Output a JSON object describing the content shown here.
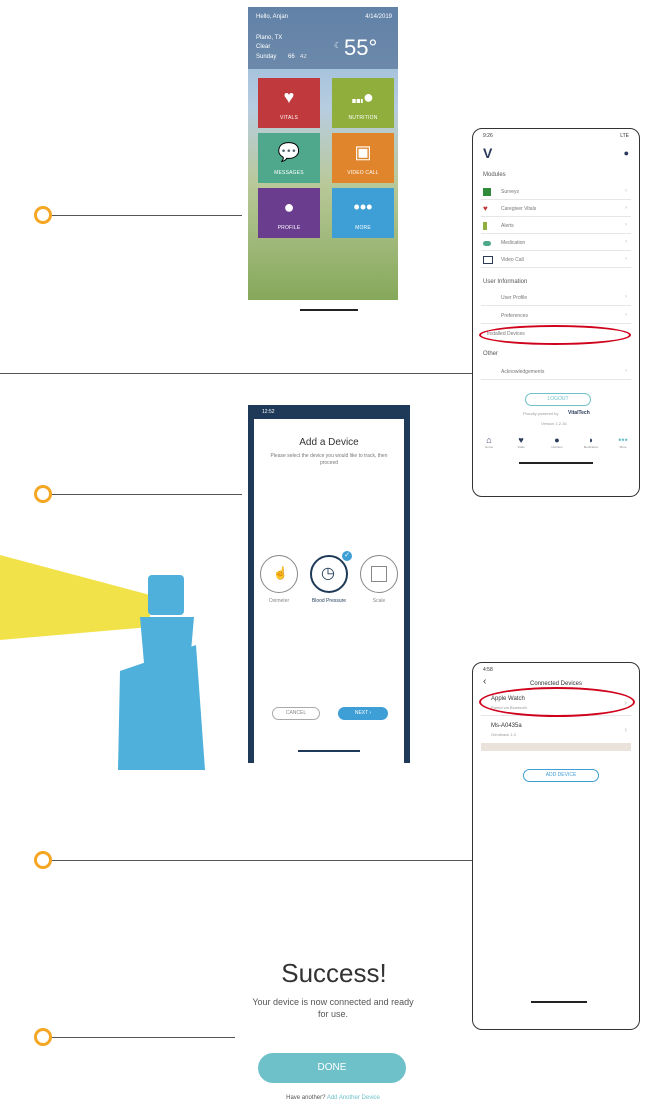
{
  "dashboard": {
    "greeting": "Hello, Anjan",
    "date": "4/14/2019",
    "city": "Plano, TX",
    "condition": "Clear",
    "day": "Sunday",
    "high": "66",
    "low": "42",
    "temperature": "55°",
    "tiles": [
      {
        "label": "VITALS",
        "color": "#c0393c",
        "icon": "heart-icon"
      },
      {
        "label": "NUTRITION",
        "color": "#8fae3c",
        "icon": "plate-cutlery-icon"
      },
      {
        "label": "MESSAGES",
        "color": "#4fa88c",
        "icon": "chat-bubbles-icon"
      },
      {
        "label": "VIDEO CALL",
        "color": "#e0852c",
        "icon": "video-call-icon"
      },
      {
        "label": "PROFILE",
        "color": "#6a3d8f",
        "icon": "person-icon"
      },
      {
        "label": "MORE",
        "color": "#3e9ed6",
        "icon": "more-dots-icon"
      }
    ]
  },
  "menu": {
    "status_time": "9:26",
    "status_right": "LTE",
    "section_modules": "Modules",
    "modules": [
      {
        "label": "Surveys",
        "color": "#2f8a3a"
      },
      {
        "label": "Caregiver Vitals",
        "color": "#c0393c"
      },
      {
        "label": "Alerts",
        "color": "#8fae3c"
      },
      {
        "label": "Medication",
        "color": "#4fa88c"
      },
      {
        "label": "Video Call",
        "color": "#2a3a5a"
      }
    ],
    "section_user": "User Information",
    "user_items": [
      "User Profile",
      "Preferences",
      "Installed Devices"
    ],
    "section_other": "Other",
    "other_items": [
      "Acknowledgements"
    ],
    "logout": "LOGOUT",
    "powered_by": "Proudly powered by",
    "brand": "VitalTech",
    "version": "Version 1.2.16",
    "tabs": [
      "Home",
      "Vitals",
      "Nutrition",
      "Medication",
      "More"
    ]
  },
  "add_device": {
    "status_time": "12:52",
    "title": "Add a Device",
    "instructions": "Please select the device you would like to track, then proceed",
    "devices": [
      "Oximeter",
      "Blood Pressure",
      "Scale"
    ],
    "cancel": "CANCEL",
    "next": "NEXT"
  },
  "connected": {
    "status_time": "4:58",
    "title": "Connected Devices",
    "devices": [
      {
        "name": "Apple Watch",
        "status": "Paired via Bluetooth"
      },
      {
        "name": "Ms-A0435a",
        "status": "Omnitrack 1.3"
      }
    ],
    "add_button": "ADD DEVICE"
  },
  "success": {
    "title": "Success!",
    "message_line1": "Your device is now connected and ready",
    "message_line2": "for use.",
    "done": "DONE",
    "prompt": "Have another?",
    "link": "Add Another Device"
  },
  "colors": {
    "accent_orange": "#f5a623",
    "highlight_red": "#d0021b",
    "lighthouse_blue": "#4fb0db",
    "beam_yellow": "#f2e24a",
    "teal_button": "#6ec1c9"
  }
}
